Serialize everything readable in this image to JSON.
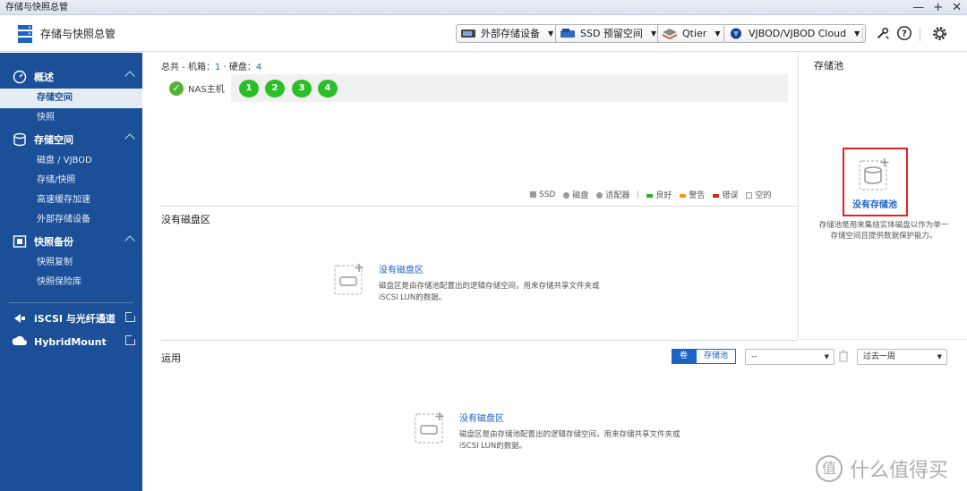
{
  "window": {
    "title": "存储与快照总管",
    "controls": [
      "—",
      "+",
      "✕"
    ]
  },
  "header": {
    "app_title": "存储与快照总管",
    "buttons": [
      {
        "label": "外部存储设备",
        "icon": "external-storage-icon"
      },
      {
        "label": "SSD 预留空间",
        "icon": "ssd-overprovision-icon"
      },
      {
        "label": "Qtier",
        "icon": "qtier-icon"
      },
      {
        "label": "VJBOD/VJBOD Cloud",
        "icon": "vjbod-cloud-icon"
      }
    ],
    "icons": [
      "diagnostic-icon",
      "help-icon",
      "settings-icon"
    ]
  },
  "sidebar": {
    "groups": [
      {
        "label": "概述",
        "icon": "overview-icon",
        "items": [
          {
            "label": "存储空间",
            "active": true
          },
          {
            "label": "快照",
            "active": false
          }
        ]
      },
      {
        "label": "存储空间",
        "icon": "storage-icon",
        "items": [
          {
            "label": "磁盘 / VJBOD"
          },
          {
            "label": "存储/快照"
          },
          {
            "label": "高速缓存加速"
          },
          {
            "label": "外部存储设备"
          }
        ]
      },
      {
        "label": "快照备份",
        "icon": "snapshot-backup-icon",
        "items": [
          {
            "label": "快照复制"
          },
          {
            "label": "快照保险库"
          }
        ]
      },
      {
        "label": "iSCSI 与光纤通道",
        "icon": "iscsi-icon",
        "items": []
      },
      {
        "label": "HybridMount",
        "icon": "hybridmount-icon",
        "items": []
      }
    ]
  },
  "summary": {
    "prefix": "总共 - 机箱：",
    "enclosures": "1",
    "mid": " · 硬盘：",
    "disks": "4"
  },
  "nas": {
    "tab_label": "NAS主机",
    "disks": [
      "1",
      "2",
      "3",
      "4"
    ]
  },
  "legend": [
    {
      "label": "SSD",
      "color": "#9a9a9a"
    },
    {
      "label": "磁盘",
      "color": "#9a9a9a"
    },
    {
      "label": "适配器",
      "color": "#9a9a9a"
    },
    {
      "label": "良好",
      "color": "#2ab02a"
    },
    {
      "label": "警告",
      "color": "#f39c12"
    },
    {
      "label": "错误",
      "color": "#d0271d"
    },
    {
      "label": "空的",
      "color": "#ffffff"
    }
  ],
  "raid_section": {
    "title": "没有磁盘区",
    "empty_title": "没有磁盘区",
    "empty_desc_1": "磁盘区是由存储池配置出的逻辑存储空间，用来存储共享文件夹或",
    "empty_desc_2": "iSCSI LUN的数据。"
  },
  "usage_section": {
    "title": "运用",
    "toggle": [
      "卷",
      "存储池"
    ],
    "select_value": "--",
    "period_value": "过去一周",
    "empty_title": "没有磁盘区",
    "empty_desc_1": "磁盘区是由存储池配置出的逻辑存储空间，用来存储共享文件夹或",
    "empty_desc_2": "iSCSI LUN的数据。"
  },
  "pool_pane": {
    "title": "存储池",
    "empty_label": "没有存储池",
    "desc": "存储池是用来集结实体磁盘以作为单一存储空间且提供数据保护能力。"
  },
  "watermark": {
    "logo": "值",
    "text": "什么值得买"
  }
}
